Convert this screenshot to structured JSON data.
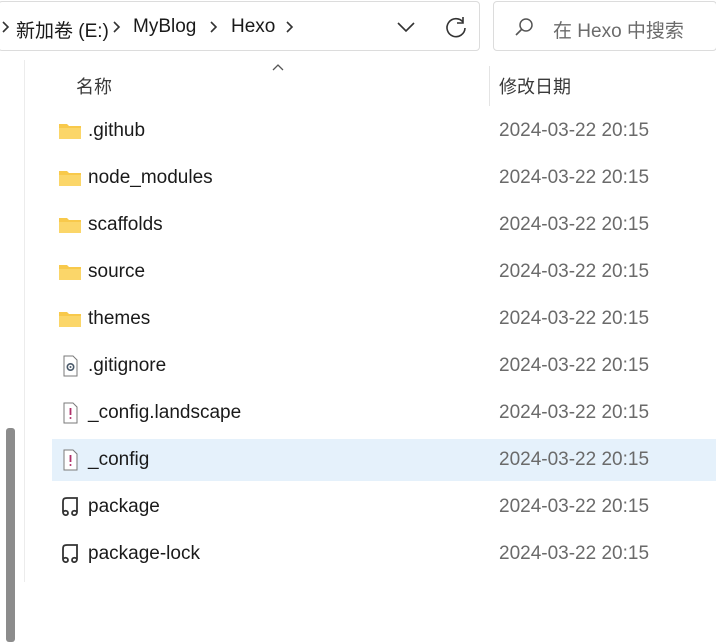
{
  "address_bar": {
    "crumbs": [
      "新加卷 (E:)",
      "MyBlog",
      "Hexo"
    ]
  },
  "search": {
    "placeholder": "在 Hexo 中搜索"
  },
  "columns": {
    "name": "名称",
    "date": "修改日期"
  },
  "files": [
    {
      "name": ".github",
      "date": "2024-03-22 20:15",
      "icon": "folder-icon"
    },
    {
      "name": "node_modules",
      "date": "2024-03-22 20:15",
      "icon": "folder-icon"
    },
    {
      "name": "scaffolds",
      "date": "2024-03-22 20:15",
      "icon": "folder-icon"
    },
    {
      "name": "source",
      "date": "2024-03-22 20:15",
      "icon": "folder-icon"
    },
    {
      "name": "themes",
      "date": "2024-03-22 20:15",
      "icon": "folder-icon"
    },
    {
      "name": ".gitignore",
      "date": "2024-03-22 20:15",
      "icon": "settings-file-icon"
    },
    {
      "name": "_config.landscape",
      "date": "2024-03-22 20:15",
      "icon": "yaml-file-icon"
    },
    {
      "name": "_config",
      "date": "2024-03-22 20:15",
      "icon": "yaml-file-icon",
      "selected": true
    },
    {
      "name": "package",
      "date": "2024-03-22 20:15",
      "icon": "json-file-icon"
    },
    {
      "name": "package-lock",
      "date": "2024-03-22 20:15",
      "icon": "json-file-icon"
    }
  ],
  "colors": {
    "selected_row": "#e5f1fb",
    "folder": "#f8c94b"
  }
}
